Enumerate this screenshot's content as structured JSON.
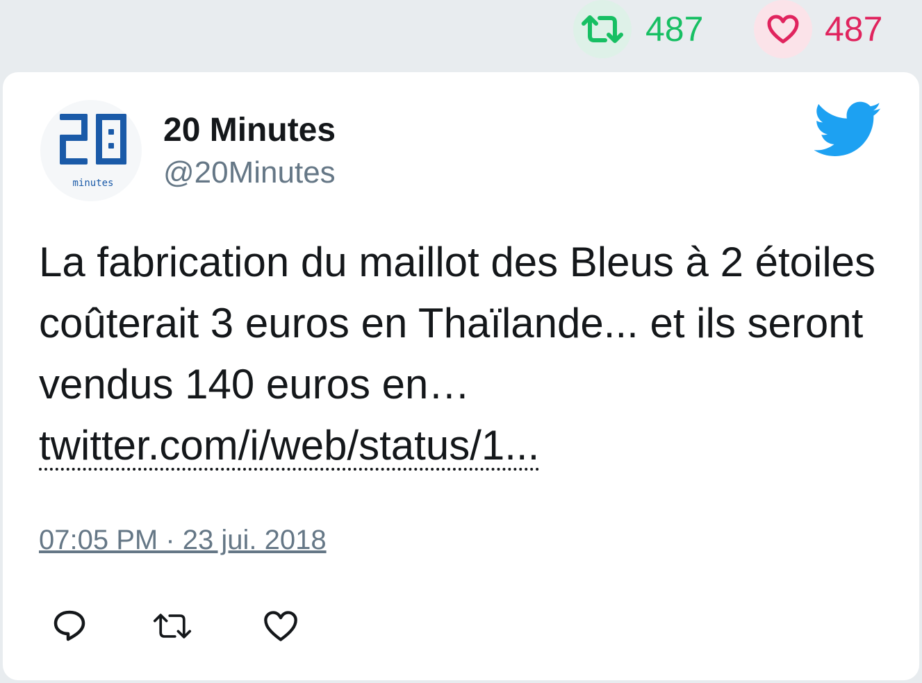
{
  "top_stats": {
    "retweet_count": "487",
    "like_count": "487",
    "retweet_icon": "retweet-icon",
    "like_icon": "heart-icon",
    "retweet_color": "#17bf63",
    "like_color": "#e0245e"
  },
  "tweet": {
    "display_name": "20 Minutes",
    "handle": "@20Minutes",
    "avatar_icon": "20-minutes-logo",
    "avatar_lettering": "20 minutes",
    "brand_icon": "twitter-bird-icon",
    "brand_color": "#1da1f2",
    "text": "La fabrication du maillot des Bleus à 2 étoiles coûterait 3 euros en Thaïlande... et ils seront vendus 140 euros en…",
    "link_text": "twitter.com/i/web/status/1...",
    "timestamp": "07:05 PM · 23 jui. 2018"
  },
  "actions": [
    {
      "name": "reply",
      "icon": "comment-icon"
    },
    {
      "name": "retweet",
      "icon": "retweet-icon"
    },
    {
      "name": "like",
      "icon": "heart-icon"
    }
  ]
}
